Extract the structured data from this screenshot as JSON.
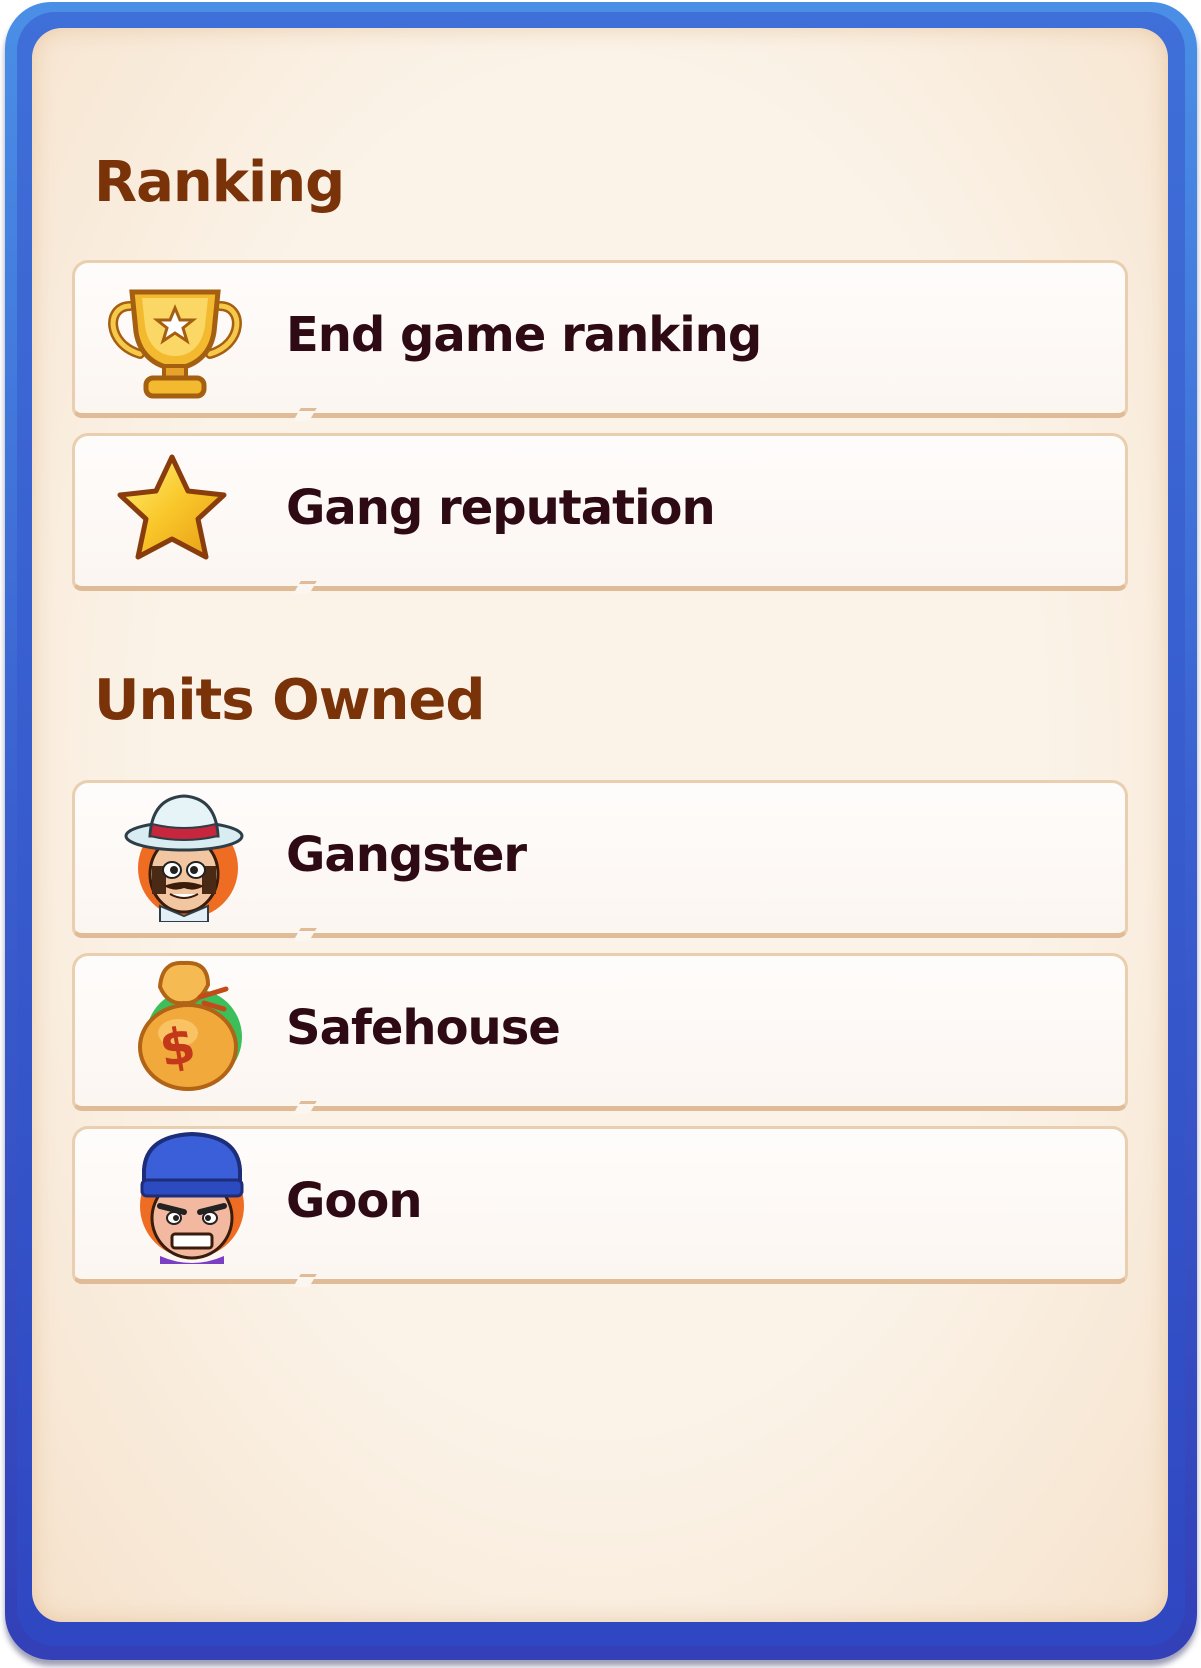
{
  "ranking": {
    "title": "Ranking",
    "items": [
      {
        "label": "End game ranking",
        "icon": "trophy-icon"
      },
      {
        "label": "Gang reputation",
        "icon": "star-icon"
      }
    ]
  },
  "units": {
    "title": "Units Owned",
    "items": [
      {
        "label": "Gangster",
        "icon": "gangster-avatar-icon"
      },
      {
        "label": "Safehouse",
        "icon": "money-bag-icon"
      },
      {
        "label": "Goon",
        "icon": "goon-avatar-icon"
      }
    ]
  },
  "colors": {
    "frame_blue": "#3a5fcf",
    "paper": "#fbf3e8",
    "heading": "#7a3208",
    "label": "#2d0a14"
  }
}
